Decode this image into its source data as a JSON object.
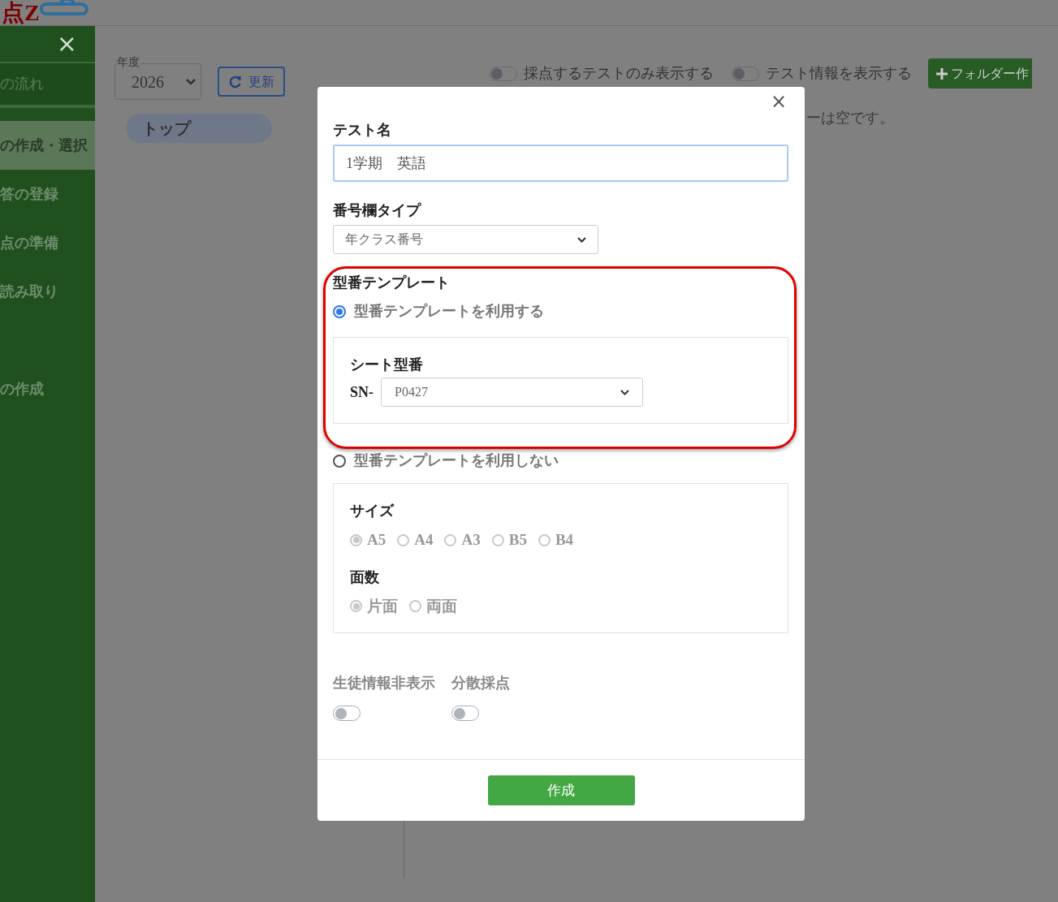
{
  "app": {
    "logo": "点Z"
  },
  "sidebar": {
    "close": "×",
    "items": [
      {
        "label": "の流れ",
        "kind": "header",
        "selected": false
      },
      {
        "label": "の作成・選択",
        "kind": "link",
        "selected": true
      },
      {
        "label": "答の登録",
        "kind": "link",
        "selected": false
      },
      {
        "label": "点の準備",
        "kind": "link",
        "selected": false
      },
      {
        "label": "読み取り",
        "kind": "link",
        "selected": false
      },
      {
        "label": "の作成",
        "kind": "link",
        "selected": false
      }
    ]
  },
  "toolbar": {
    "year_label": "年度",
    "year": "2026",
    "refresh": "更新",
    "breadcrumb": "トップ",
    "toggles": [
      {
        "label": "採点するテストのみ表示する",
        "on": false
      },
      {
        "label": "テスト情報を表示する",
        "on": false
      }
    ],
    "new_folder": "フォルダー作"
  },
  "empty_message": "ーは空です。",
  "dialog": {
    "close": "×",
    "name_label": "テスト名",
    "name_value": "1学期　英語",
    "number_type_label": "番号欄タイプ",
    "number_type_value": "年クラス番号",
    "template_label": "型番テンプレート",
    "template_options": [
      {
        "label": "型番テンプレートを利用する",
        "selected": true
      },
      {
        "label": "型番テンプレートを利用しない",
        "selected": false
      }
    ],
    "sheet_label": "シート型番",
    "sheet_prefix": "SN-",
    "sheet_value": "P0427",
    "size_label": "サイズ",
    "sizes": [
      {
        "label": "A5",
        "selected": true,
        "disabled": true
      },
      {
        "label": "A4",
        "selected": false,
        "disabled": true
      },
      {
        "label": "A3",
        "selected": false,
        "disabled": true
      },
      {
        "label": "B5",
        "selected": false,
        "disabled": true
      },
      {
        "label": "B4",
        "selected": false,
        "disabled": true
      }
    ],
    "sides_label": "面数",
    "sides": [
      {
        "label": "片面",
        "selected": true,
        "disabled": true
      },
      {
        "label": "両面",
        "selected": false,
        "disabled": true
      }
    ],
    "switches": [
      {
        "label": "生徒情報非表示",
        "on": false
      },
      {
        "label": "分散採点",
        "on": false
      }
    ],
    "submit": "作成"
  }
}
